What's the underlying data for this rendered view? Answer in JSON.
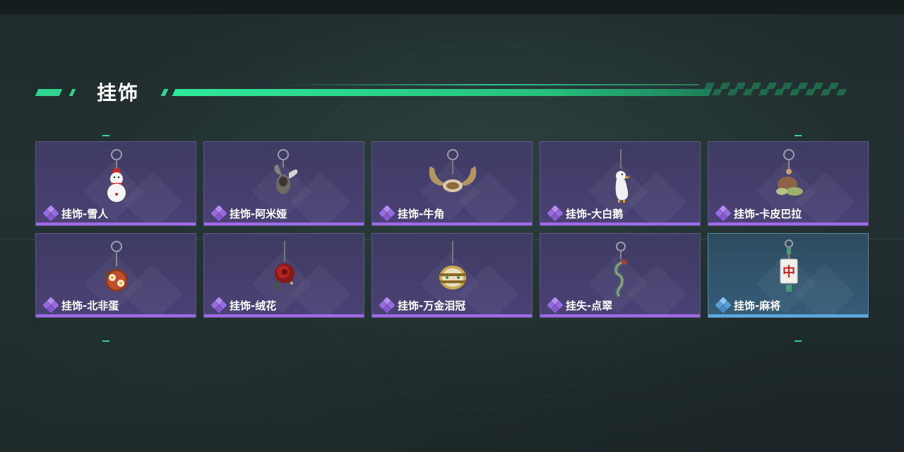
{
  "section": {
    "title": "挂饰",
    "accent_color": "#2fd48e"
  },
  "items": [
    {
      "name": "挂饰-雪人",
      "rarity": "purple",
      "icon": "snowman-charm-icon"
    },
    {
      "name": "挂饰-阿米娅",
      "rarity": "purple",
      "icon": "rabbit-charm-icon"
    },
    {
      "name": "挂饰-牛角",
      "rarity": "purple",
      "icon": "horns-charm-icon"
    },
    {
      "name": "挂饰-大白鹅",
      "rarity": "purple",
      "icon": "goose-charm-icon"
    },
    {
      "name": "挂饰-卡皮巴拉",
      "rarity": "purple",
      "icon": "capybara-charm-icon"
    },
    {
      "name": "挂饰-北非蛋",
      "rarity": "purple",
      "icon": "shakshuka-charm-icon"
    },
    {
      "name": "挂饰-绒花",
      "rarity": "purple",
      "icon": "rose-charm-icon"
    },
    {
      "name": "挂饰-万金泪冠",
      "rarity": "purple",
      "icon": "crown-charm-icon"
    },
    {
      "name": "挂失-点翠",
      "rarity": "purple",
      "icon": "dragon-charm-icon"
    },
    {
      "name": "挂饰-麻将",
      "rarity": "blue",
      "icon": "mahjong-tile-charm-icon",
      "tile_char": "中"
    }
  ],
  "colors": {
    "purple_stripe": "#a069e8",
    "blue_stripe": "#57a8e3"
  }
}
